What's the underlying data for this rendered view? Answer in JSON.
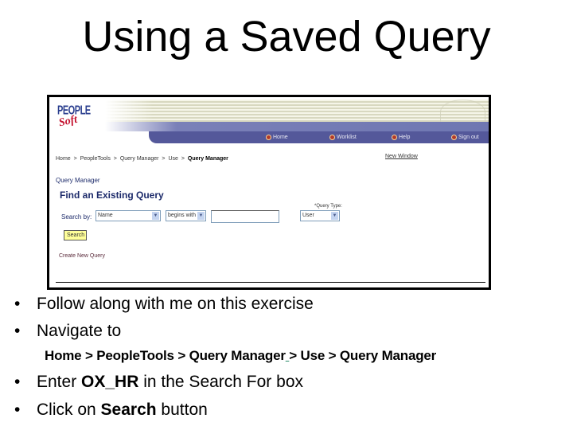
{
  "slide": {
    "title": "Using a Saved Query"
  },
  "screenshot": {
    "logo": {
      "line1": "PEOPLE",
      "line2": "Soft"
    },
    "nav": [
      {
        "label": "Home",
        "icon": "home-icon"
      },
      {
        "label": "Worklist",
        "icon": "worklist-icon"
      },
      {
        "label": "Help",
        "icon": "help-icon"
      },
      {
        "label": "Sign out",
        "icon": "sign-out-icon"
      }
    ],
    "breadcrumb": [
      "Home",
      ">",
      "PeopleTools",
      ">",
      "Query Manager",
      ">",
      "Use",
      ">"
    ],
    "breadcrumb_current": "Query Manager",
    "new_window_link": "New Window",
    "section_label": "Query Manager",
    "page_title": "Find an Existing Query",
    "search_by_label": "Search by:",
    "search_by_select": "Name",
    "operator_select": "begins with",
    "search_input_value": "",
    "query_type_label": "*Query Type:",
    "query_type_select": "User",
    "search_button": "Search",
    "create_link": "Create New Query"
  },
  "bullets": {
    "b1": "Follow along with me on this exercise",
    "b2": "Navigate to",
    "path_part1": "Home > PeopleTools > Query  Manager",
    "path_underlined": " ",
    "path_part2": " > Use > Query Manager",
    "b3_pre": "Enter ",
    "b3_bold": "OX_HR",
    "b3_post": " in the Search For box",
    "b4_pre": "Click on ",
    "b4_bold": "Search",
    "b4_post": " button",
    "bullet_char": "•"
  }
}
